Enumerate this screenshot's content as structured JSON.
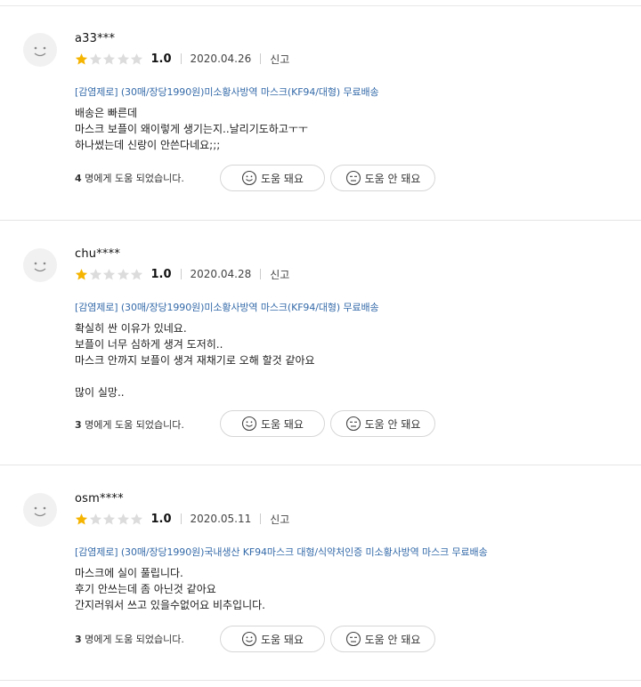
{
  "reviews": [
    {
      "username": "a33***",
      "score": "1.0",
      "stars_filled": 1,
      "stars_total": 5,
      "date": "2020.04.26",
      "report_label": "신고",
      "product": "[감염제로] (30매/장당1990원)미소황사방역 마스크(KF94/대형) 무료배송",
      "body": "배송은 빠른데\n마스크 보플이 왜이렇게 생기는지..날리기도하고ㅜㅜ\n하나썼는데 신랑이 안쓴다네요;;;",
      "helpful_count": "4",
      "helpful_suffix": " 명에게 도움 되었습니다.",
      "helpful_btn": "도움 돼요",
      "unhelpful_btn": "도움 안 돼요"
    },
    {
      "username": "chu****",
      "score": "1.0",
      "stars_filled": 1,
      "stars_total": 5,
      "date": "2020.04.28",
      "report_label": "신고",
      "product": "[감염제로] (30매/장당1990원)미소황사방역 마스크(KF94/대형) 무료배송",
      "body": "확실히 싼 이유가 있네요.\n보플이 너무 심하게 생겨 도저히..\n마스크 안까지 보플이 생겨 재채기로 오해 할것 같아요\n\n많이 실망..",
      "helpful_count": "3",
      "helpful_suffix": " 명에게 도움 되었습니다.",
      "helpful_btn": "도움 돼요",
      "unhelpful_btn": "도움 안 돼요"
    },
    {
      "username": "osm****",
      "score": "1.0",
      "stars_filled": 1,
      "stars_total": 5,
      "date": "2020.05.11",
      "report_label": "신고",
      "product": "[감염제로] (30매/장당1990원)국내생산 KF94마스크 대형/식약처인증 미소황사방역 마스크 무료배송",
      "body": "마스크에 실이 풀립니다.\n후기 안쓰는데 좀 아닌것 같아요\n간지러워서 쓰고 있을수없어요 비추입니다.",
      "helpful_count": "3",
      "helpful_suffix": " 명에게 도움 되었습니다.",
      "helpful_btn": "도움 돼요",
      "unhelpful_btn": "도움 안 돼요"
    }
  ],
  "colors": {
    "star_filled": "#f5b400",
    "star_empty": "#dcdcdc",
    "product_link": "#346aa9"
  }
}
